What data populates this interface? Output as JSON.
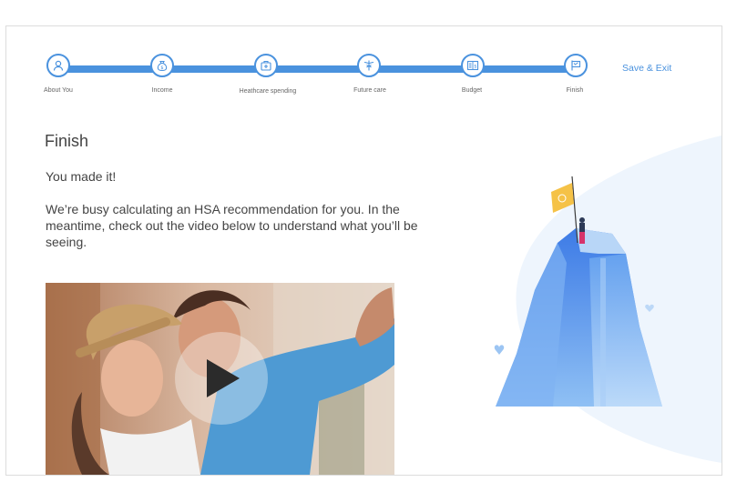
{
  "colors": {
    "accent": "#4a92de",
    "text": "#444444"
  },
  "stepper": {
    "steps": [
      {
        "label": "About You",
        "icon": "person-icon"
      },
      {
        "label": "Income",
        "icon": "money-bag-icon"
      },
      {
        "label": "Heathcare spending",
        "icon": "medical-bag-icon"
      },
      {
        "label": "Future care",
        "icon": "caduceus-icon"
      },
      {
        "label": "Budget",
        "icon": "ledger-icon"
      },
      {
        "label": "Finish",
        "icon": "flag-icon"
      }
    ]
  },
  "header": {
    "save_exit": "Save & Exit"
  },
  "main": {
    "title": "Finish",
    "made_it": "You made it!",
    "body": "We’re busy calculating an HSA recommendation for you. In the meantime, check out the video below to understand what you’ll be seeing."
  },
  "video": {
    "play_icon": "play-icon"
  },
  "illustration": {
    "icon": "mountain-flag-illustration"
  }
}
